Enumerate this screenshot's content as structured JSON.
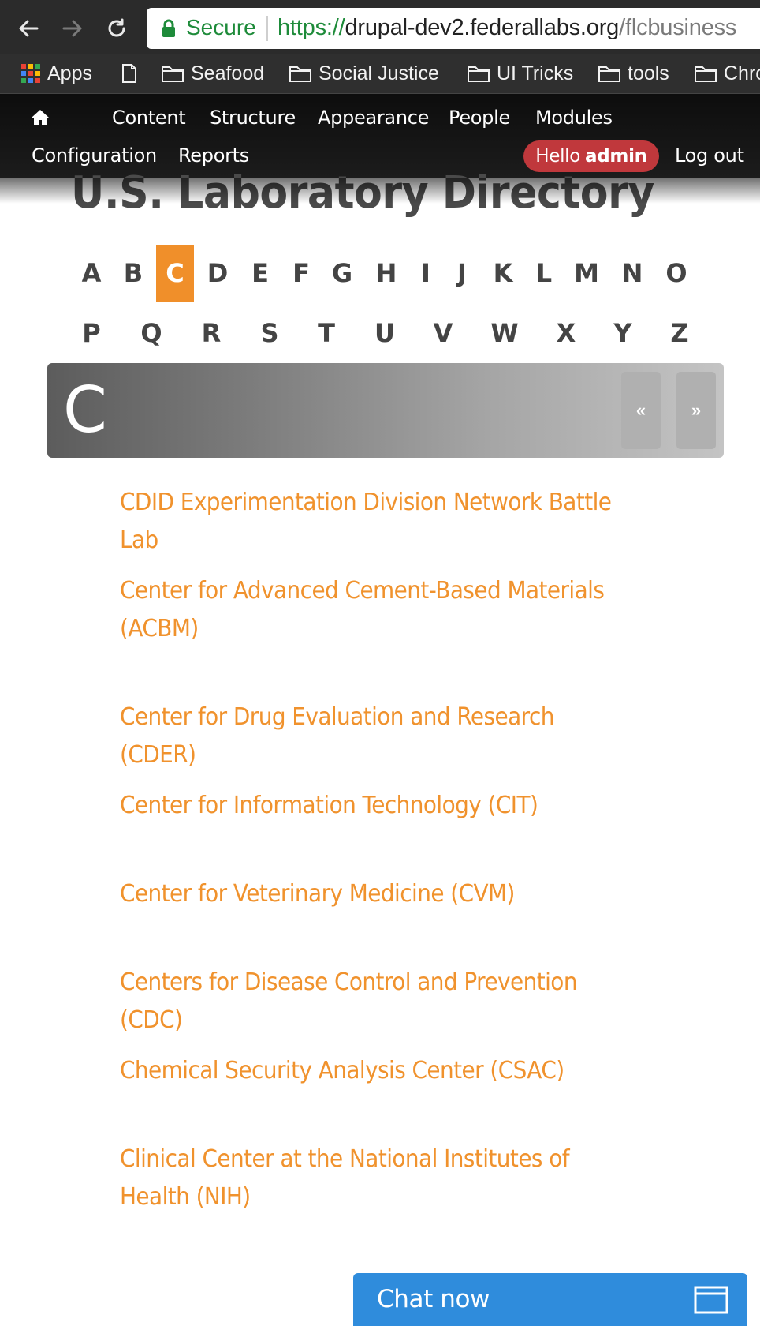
{
  "browser": {
    "secure_label": "Secure",
    "url_scheme": "https://",
    "url_host": "drupal-dev2.federallabs.org",
    "url_path": "/flcbusiness",
    "bookmarks": [
      {
        "label": "Apps",
        "icon": "apps-grid-icon"
      },
      {
        "label": "",
        "icon": "page-icon"
      },
      {
        "label": "Seafood",
        "icon": "folder-icon"
      },
      {
        "label": "Social Justice",
        "icon": "folder-icon"
      },
      {
        "label": "UI Tricks",
        "icon": "folder-icon"
      },
      {
        "label": "tools",
        "icon": "folder-icon"
      },
      {
        "label": "Chro",
        "icon": "folder-icon"
      }
    ]
  },
  "toolbar": {
    "home_icon": "home-icon",
    "menu": [
      "Content",
      "Structure",
      "Appearance",
      "People",
      "Modules",
      "Configuration",
      "Reports"
    ],
    "hello_prefix": "Hello",
    "hello_user": "admin",
    "logout": "Log out",
    "accent": "#c0383c"
  },
  "page": {
    "title": "U.S. Laboratory Directory",
    "alphabet_row1": [
      "A",
      "B",
      "C",
      "D",
      "E",
      "F",
      "G",
      "H",
      "I",
      "J",
      "K",
      "L",
      "M",
      "N",
      "O"
    ],
    "alphabet_row2": [
      "P",
      "Q",
      "R",
      "S",
      "T",
      "U",
      "V",
      "W",
      "X",
      "Y",
      "Z"
    ],
    "active_letter": "C",
    "banner_letter": "C",
    "prev_label": "«",
    "next_label": "»",
    "link_color": "#f0922d",
    "labs": [
      "CDID Experimentation Division Network Battle Lab",
      "Center for Advanced Cement-Based Materials (ACBM)",
      "Center for Drug Evaluation and Research (CDER)",
      "Center for Information Technology (CIT)",
      "Center for Veterinary Medicine (CVM)",
      "Centers for Disease Control and Prevention (CDC)",
      "Chemical Security Analysis Center (CSAC)",
      "Clinical Center at the National Institutes of Health (NIH)"
    ]
  },
  "chat": {
    "label": "Chat now",
    "icon": "window-icon",
    "color": "#2f8cdc"
  }
}
